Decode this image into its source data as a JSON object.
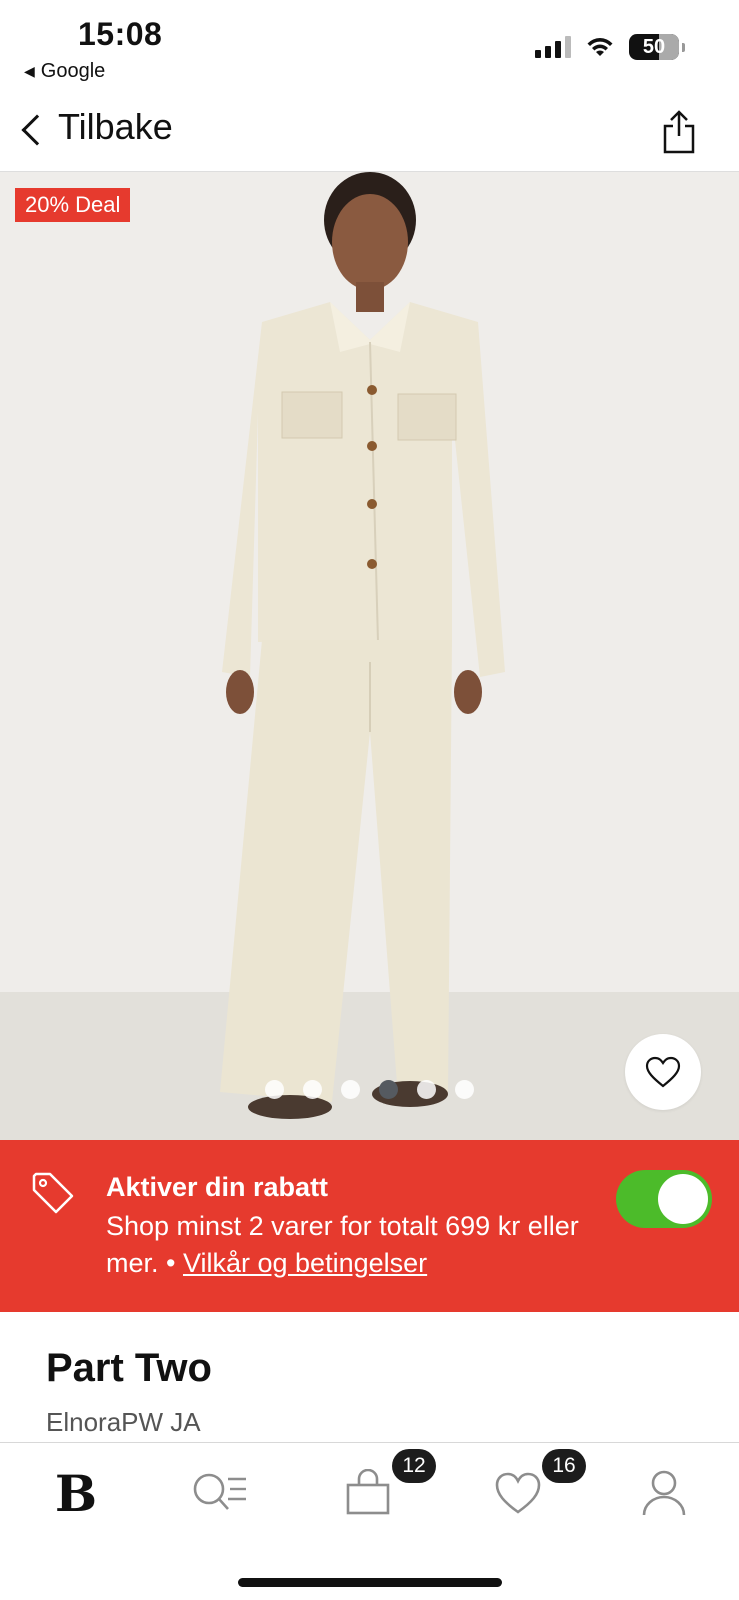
{
  "status_bar": {
    "time": "15:08",
    "back_app": "Google",
    "battery": "50"
  },
  "nav": {
    "back_label": "Tilbake"
  },
  "product_image": {
    "deal_badge": "20% Deal",
    "dots_count": 6,
    "active_dot_index": 3
  },
  "promo": {
    "title": "Aktiver din rabatt",
    "description": "Shop minst 2 varer for totalt 699 kr eller mer. •",
    "terms_link": "Vilkår og betingelser",
    "toggle_on": true,
    "color": "#e63a2e",
    "toggle_color": "#4cbb2a"
  },
  "product": {
    "brand": "Part Two",
    "name": "ElnoraPW JA"
  },
  "tabbar": {
    "home_logo": "B",
    "bag_count": "12",
    "favorites_count": "16"
  }
}
